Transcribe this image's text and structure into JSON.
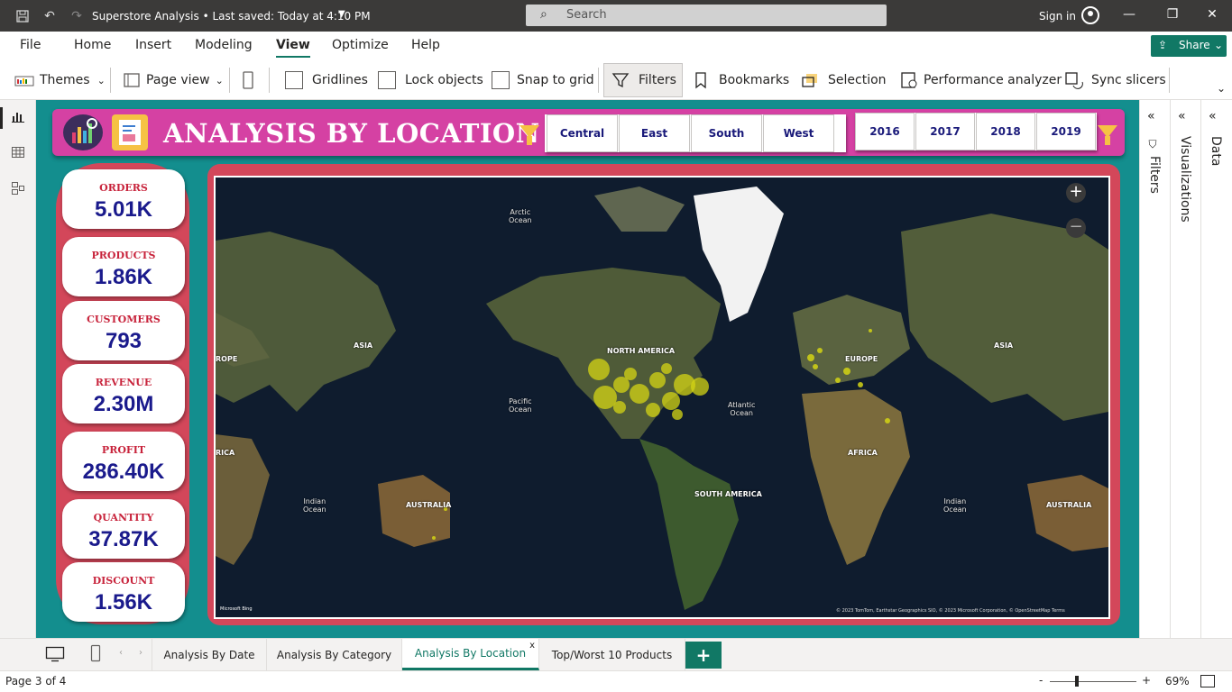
{
  "titlebar": {
    "title": "Superstore Analysis • Last saved: Today at 4:10 PM",
    "search_placeholder": "Search",
    "sign_in": "Sign in"
  },
  "menu": {
    "items": [
      "File",
      "Home",
      "Insert",
      "Modeling",
      "View",
      "Optimize",
      "Help"
    ],
    "active": "View",
    "share": "Share"
  },
  "ribbon": {
    "themes": "Themes",
    "page_view": "Page view",
    "gridlines": "Gridlines",
    "lock_objects": "Lock objects",
    "snap_to_grid": "Snap to grid",
    "filters": "Filters",
    "bookmarks": "Bookmarks",
    "selection": "Selection",
    "performance_analyzer": "Performance analyzer",
    "sync_slicers": "Sync slicers"
  },
  "report": {
    "title": "ANALYSIS BY LOCATION",
    "regions": [
      "Central",
      "East",
      "South",
      "West"
    ],
    "years": [
      "2016",
      "2017",
      "2018",
      "2019"
    ],
    "kpis": [
      {
        "label": "ORDERS",
        "value": "5.01K"
      },
      {
        "label": "PRODUCTS",
        "value": "1.86K"
      },
      {
        "label": "CUSTOMERS",
        "value": "793"
      },
      {
        "label": "REVENUE",
        "value": "2.30M"
      },
      {
        "label": "PROFIT",
        "value": "286.40K"
      },
      {
        "label": "QUANTITY",
        "value": "37.87K"
      },
      {
        "label": "DISCOUNT",
        "value": "1.56K"
      }
    ],
    "map": {
      "labels": {
        "arctic": "Arctic\nOcean",
        "north_america": "NORTH AMERICA",
        "pacific": "Pacific\nOcean",
        "atlantic": "Atlantic\nOcean",
        "south_america": "SOUTH AMERICA",
        "indian_left": "Indian\nOcean",
        "indian_right": "Indian\nOcean",
        "asia_left": "ASIA",
        "asia_right": "ASIA",
        "europe_left": "ROPE",
        "europe": "EUROPE",
        "africa_left": "RICA",
        "africa": "AFRICA",
        "australia_left": "AUSTRALIA",
        "australia_right": "AUSTRALIA"
      },
      "attribution": "© 2023 TomTom, Earthstar Geographics SIO, © 2023 Microsoft Corporation, © OpenStreetMap  Terms",
      "provider": "Microsoft Bing",
      "bubble_color": "#d4d414"
    }
  },
  "panels": {
    "filters": "Filters",
    "visualizations": "Visualizations",
    "data": "Data"
  },
  "tabs": [
    "Analysis By Date",
    "Analysis By Category",
    "Analysis By Location",
    "Top/Worst 10 Products"
  ],
  "active_tab": "Analysis By Location",
  "status": {
    "page": "Page 3 of 4",
    "zoom": "69%"
  },
  "colors": {
    "accent": "#117865",
    "canvas_bg": "#138e8e",
    "header_bg": "#d541a3",
    "kpi_strip": "#d3475a",
    "kpi_value": "#1a1a8c",
    "kpi_label": "#c8243c"
  }
}
